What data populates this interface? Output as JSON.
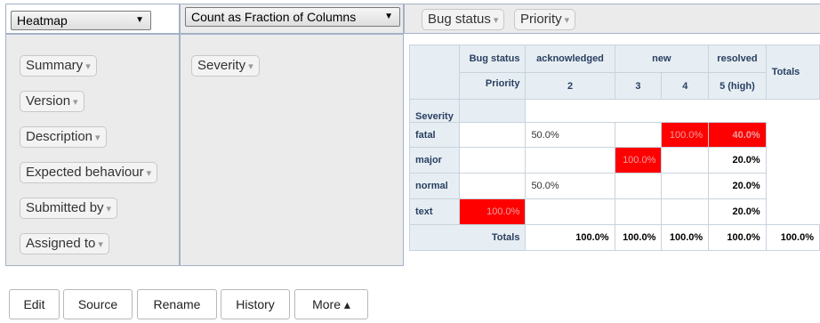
{
  "renderer": {
    "value": "Heatmap",
    "arrow": "▼"
  },
  "aggregator": {
    "value": "Count as Fraction of Columns",
    "arrow": "▼"
  },
  "col_attrs": [
    {
      "label": "Bug status",
      "tri": "▾"
    },
    {
      "label": "Priority",
      "tri": "▾"
    }
  ],
  "unused_attrs": [
    {
      "label": "Summary",
      "tri": "▾"
    },
    {
      "label": "Version",
      "tri": "▾"
    },
    {
      "label": "Description",
      "tri": "▾"
    },
    {
      "label": "Expected behaviour",
      "tri": "▾"
    },
    {
      "label": "Submitted by",
      "tri": "▾"
    },
    {
      "label": "Assigned to",
      "tri": "▾"
    }
  ],
  "row_attrs": [
    {
      "label": "Severity",
      "tri": "▾"
    }
  ],
  "table": {
    "bug_status_label": "Bug status",
    "priority_label": "Priority",
    "severity_label": "Severity",
    "statuses": [
      "acknowledged",
      "new",
      "resolved"
    ],
    "priorities": [
      "2",
      "3",
      "4",
      "5 (high)"
    ],
    "totals_label": "Totals",
    "rows": [
      {
        "label": "fatal",
        "cells": [
          "",
          "50.0%",
          "",
          "100.0%"
        ],
        "total": "40.0%"
      },
      {
        "label": "major",
        "cells": [
          "",
          "",
          "100.0%",
          ""
        ],
        "total": "20.0%"
      },
      {
        "label": "normal",
        "cells": [
          "",
          "50.0%",
          "",
          ""
        ],
        "total": "20.0%"
      },
      {
        "label": "text",
        "cells": [
          "100.0%",
          "",
          "",
          ""
        ],
        "total": "20.0%"
      }
    ],
    "col_totals": [
      "100.0%",
      "100.0%",
      "100.0%",
      "100.0%",
      "100.0%"
    ]
  },
  "buttons": {
    "edit": "Edit",
    "source": "Source",
    "rename": "Rename",
    "history": "History",
    "more": "More ▴"
  },
  "colors": {
    "heat_max": "#ff0000",
    "header_bg": "#e6eef4",
    "panel_bg": "#ebebeb"
  }
}
